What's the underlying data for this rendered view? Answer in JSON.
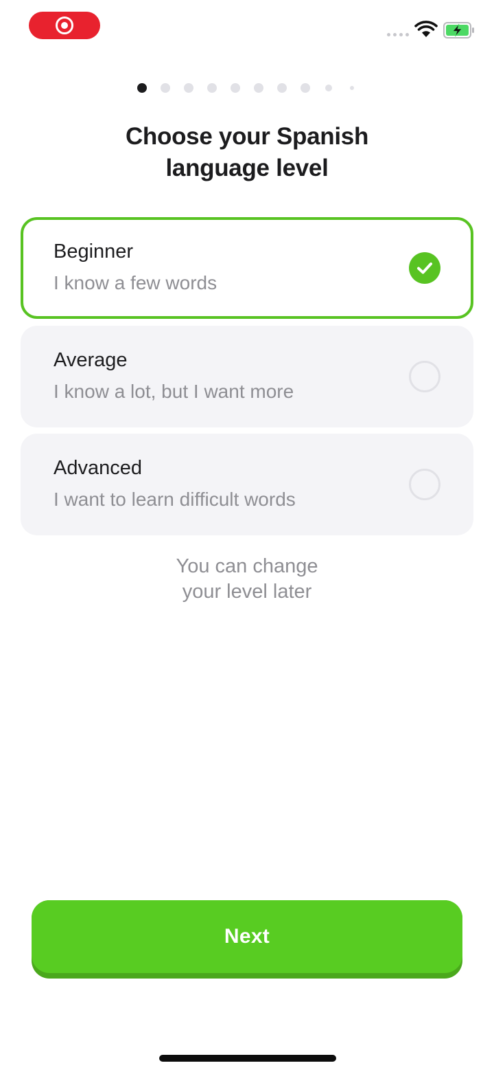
{
  "status_bar": {
    "recording_icon": "screen-record-icon",
    "signal_icon": "cellular-signal-icon",
    "wifi_icon": "wifi-icon",
    "battery_icon": "battery-charging-icon",
    "recording_color": "#e8222e",
    "battery_color": "#4cd964"
  },
  "pager": {
    "total": 10,
    "current": 1
  },
  "header": {
    "title_line1": "Choose your Spanish",
    "title_line2": "language level"
  },
  "options": [
    {
      "title": "Beginner",
      "subtitle": "I know a few words",
      "selected": true
    },
    {
      "title": "Average",
      "subtitle": "I know a lot, but I want more",
      "selected": false
    },
    {
      "title": "Advanced",
      "subtitle": "I want to learn difficult words",
      "selected": false
    }
  ],
  "hint": {
    "line1": "You can change",
    "line2": "your level later"
  },
  "footer": {
    "next_label": "Next"
  },
  "colors": {
    "accent": "#58cc22",
    "selected_border": "#58c322",
    "option_background": "#f4f4f7",
    "muted_text": "#8e8e93"
  }
}
